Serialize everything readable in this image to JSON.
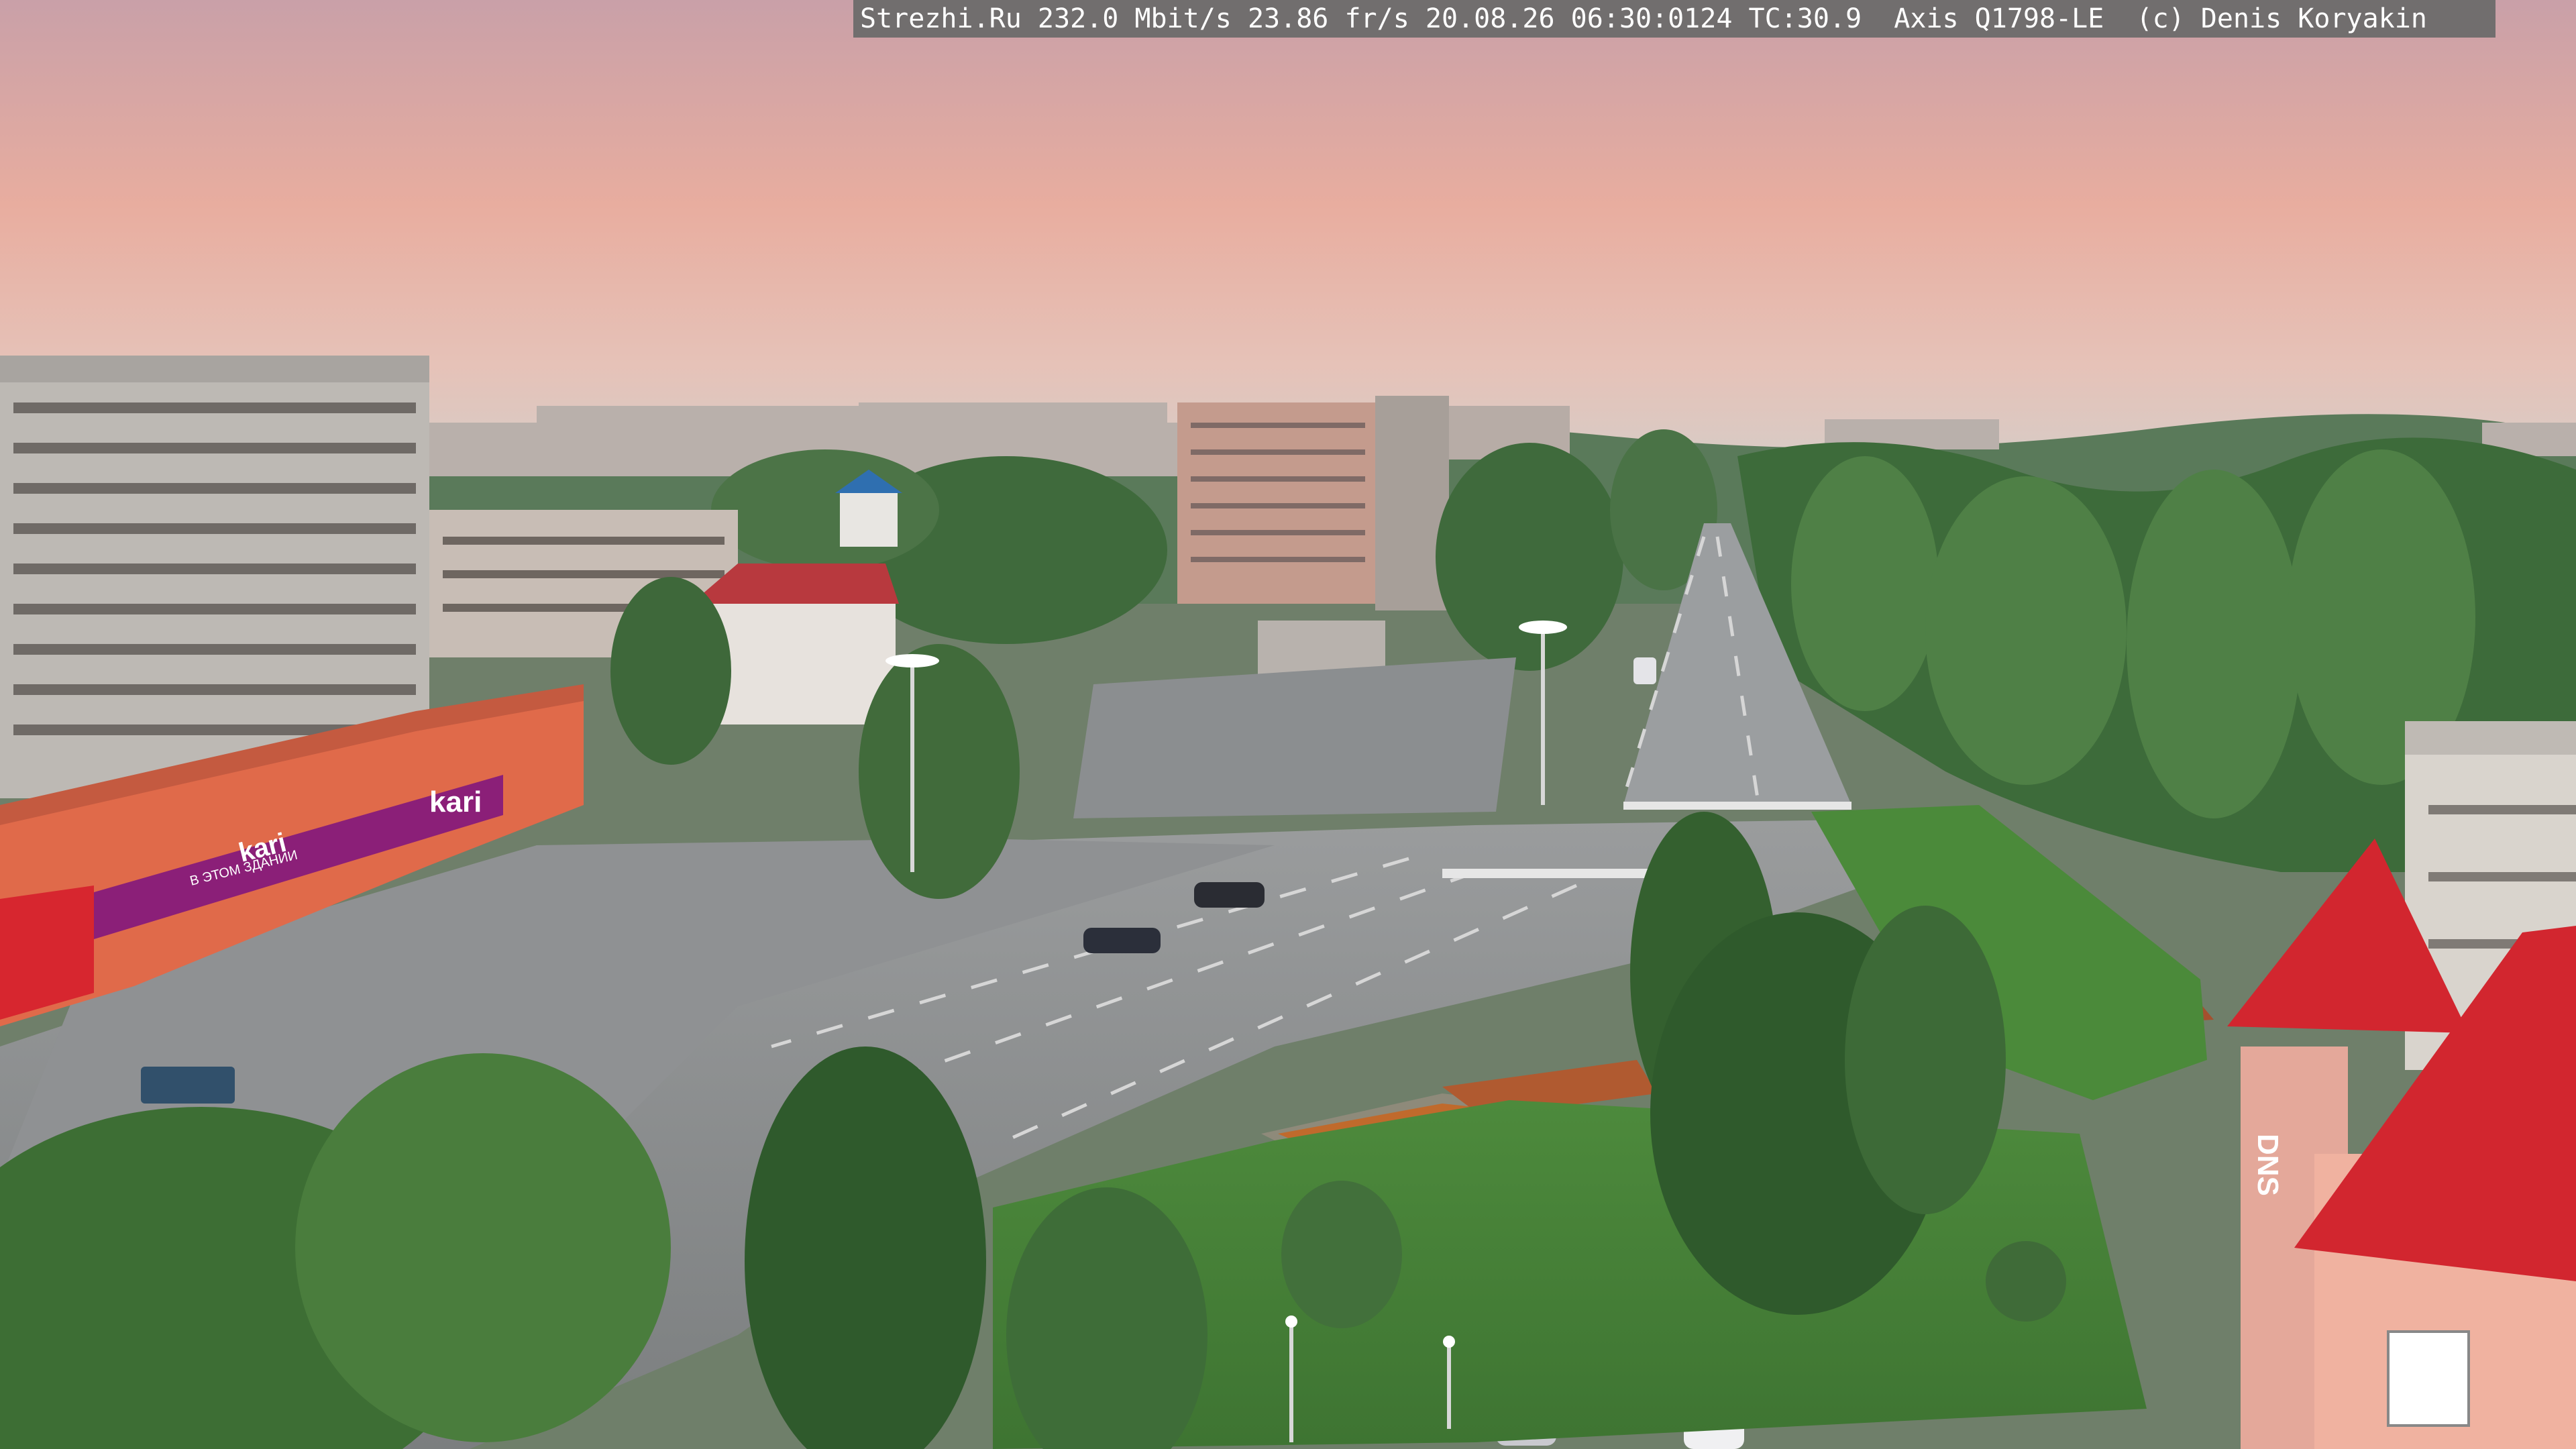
{
  "overlay": {
    "text": "Strezhi.Ru 232.0 Mbit/s 23.86 fr/s 20.08.26 06:30:0124 TC:30.9  Axis Q1798-LE  (c) Denis Koryakin"
  },
  "storefront": {
    "sign_main": "kari",
    "sign_front": "kari",
    "sign_front_prefix": "В ЭТОМ ЗДАНИИ"
  },
  "right_building_sign": "DNS",
  "colors": {
    "sky_top": "#c9a7ad",
    "sky_mid": "#e6b0a6",
    "sky_horizon": "#d9c7c0",
    "foliage": "#3f6b3a",
    "road": "#8a8d8c",
    "roof_red": "#cc2c34",
    "kari_purple": "#8b1f78"
  }
}
